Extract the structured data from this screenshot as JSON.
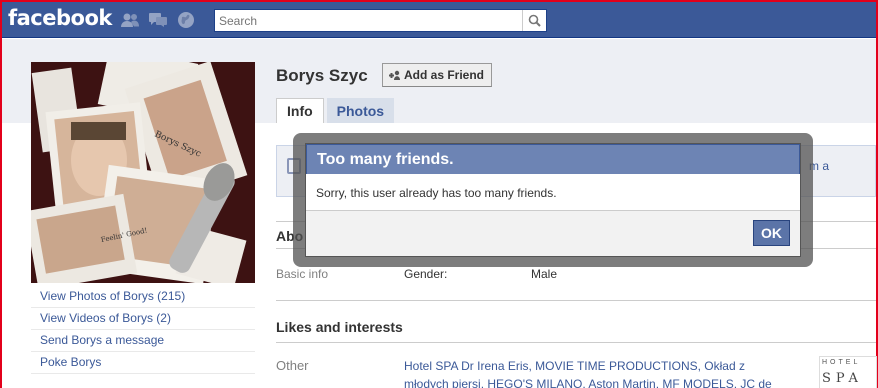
{
  "header": {
    "logo": "facebook",
    "jewels": [
      "friends-icon",
      "messages-icon",
      "notifications-icon"
    ],
    "search": {
      "placeholder": "Search",
      "value": ""
    }
  },
  "profile": {
    "name": "Borys Szyc",
    "add_friend_label": "Add as Friend",
    "tabs": [
      {
        "label": "Info",
        "active": true
      },
      {
        "label": "Photos",
        "active": false
      }
    ],
    "left_links": [
      "View Photos of Borys (215)",
      "View Videos of Borys (2)",
      "Send Borys a message",
      "Poke Borys"
    ],
    "info_box_text": "m a",
    "about_heading": "Abo",
    "basic_info": {
      "label": "Basic info",
      "key": "Gender:",
      "value": "Male"
    },
    "likes_heading": "Likes and interests",
    "other_label": "Other",
    "other_value": "Hotel SPA Dr Irena Eris, MOVIE TIME PRODUCTIONS, Okład z młodych piersi, HEGO'S MILANO, Aston Martin, MF MODELS, JC de",
    "thumb_text": [
      "HOTEL",
      "SPA"
    ]
  },
  "dialog": {
    "title": "Too many friends.",
    "message": "Sorry, this user already has too many friends.",
    "ok_label": "OK"
  },
  "colors": {
    "brand": "#3b5998",
    "dialog_title": "#6d84b4",
    "page_bg": "#edeff4",
    "window_border": "#e3001b"
  }
}
